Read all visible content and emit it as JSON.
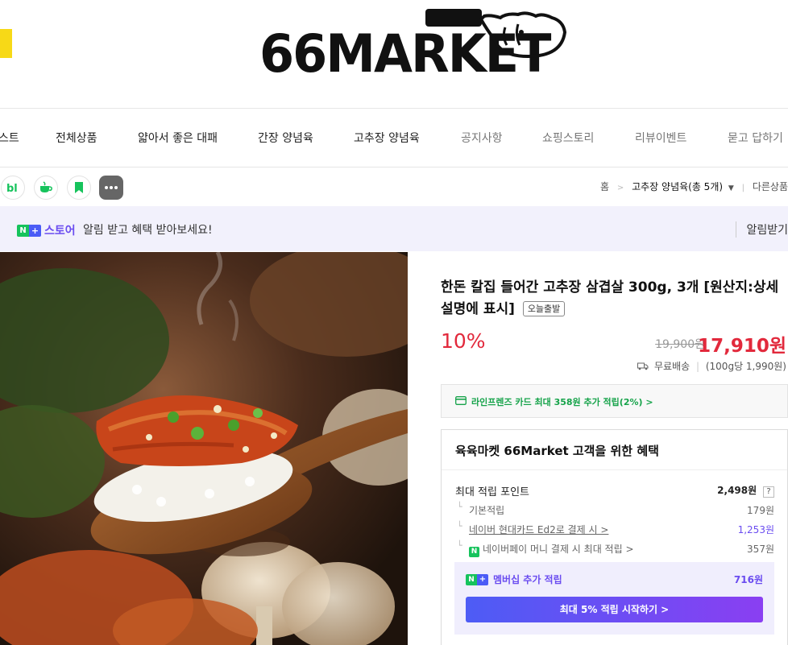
{
  "brand": {
    "logo_text": "66MARKET"
  },
  "nav": {
    "items": [
      {
        "label": "스트",
        "style": "dark"
      },
      {
        "label": "전체상품",
        "style": "dark"
      },
      {
        "label": "얇아서 좋은 대패",
        "style": "dark"
      },
      {
        "label": "간장 양념육",
        "style": "dark"
      },
      {
        "label": "고추장 양념육",
        "style": "dark"
      },
      {
        "label": "공지사항",
        "style": "grey"
      },
      {
        "label": "쇼핑스토리",
        "style": "grey"
      },
      {
        "label": "리뷰이벤트",
        "style": "grey"
      },
      {
        "label": "묻고 답하기",
        "style": "grey"
      }
    ]
  },
  "utility": {
    "icons": [
      "blog-icon",
      "cafe-icon",
      "bookmark-icon",
      "more-icon"
    ],
    "breadcrumb": {
      "home": "홈",
      "category": "고추장 양념육(총 5개)",
      "other": "다른상품"
    }
  },
  "banner": {
    "badge_n": "N",
    "badge_plus": "+",
    "store": "스토어",
    "text": "알림 받고 혜택 받아보세요!",
    "right": "알림받기"
  },
  "product": {
    "title": "한돈 칼집 들어간 고추장 삼겹살 300g, 3개 [원산지:상세설명에 표시]",
    "badge": "오늘출발",
    "discount": "10%",
    "original_price": "19,900원",
    "price": "17,910원",
    "shipping": "무료배송",
    "unit_price": "(100g당 1,990원)"
  },
  "card_offer": {
    "text": "라인프렌즈 카드 최대 358원 추가 적립(2%) >"
  },
  "benefits": {
    "title": "육육마켓 66Market 고객을 위한 혜택",
    "max_points_label": "최대 적립 포인트",
    "max_points_value": "2,498원",
    "help": "?",
    "rows": [
      {
        "label": "기본적립",
        "value": "179원",
        "link": false
      },
      {
        "label": "네이버 현대카드 Ed2로 결제 시 >",
        "value": "1,253원",
        "link": true
      },
      {
        "label": "네이버페이 머니 결제 시 최대 적립 >",
        "value": "357원",
        "link": false,
        "np": true
      }
    ],
    "member_label": "멤버십 추가 적립",
    "member_value": "716원",
    "member_button": "최대 5% 적립 시작하기 >"
  },
  "colors": {
    "accent_red": "#e2293c",
    "naver_green": "#16c35c",
    "purple": "#6a4cf0"
  }
}
